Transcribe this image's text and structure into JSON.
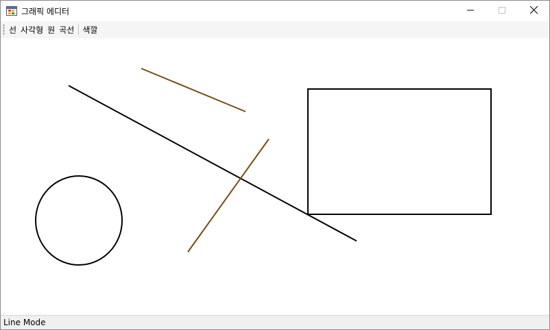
{
  "window": {
    "title": "그래픽 에디터",
    "controls": {
      "minimize_icon": "minimize-icon",
      "maximize_icon": "maximize-icon",
      "close_icon": "close-icon"
    }
  },
  "menu": {
    "items": [
      {
        "label": "선"
      },
      {
        "label": "사각형"
      },
      {
        "label": "원"
      },
      {
        "label": "곡선"
      },
      {
        "label": "색깔"
      }
    ]
  },
  "canvas": {
    "shapes": [
      {
        "type": "line",
        "color": "#000000"
      },
      {
        "type": "line",
        "color": "#7a4a0a"
      },
      {
        "type": "line",
        "color": "#7a4a0a"
      },
      {
        "type": "rectangle",
        "color": "#000000"
      },
      {
        "type": "circle",
        "color": "#000000"
      }
    ]
  },
  "status": {
    "text": "Line Mode"
  }
}
